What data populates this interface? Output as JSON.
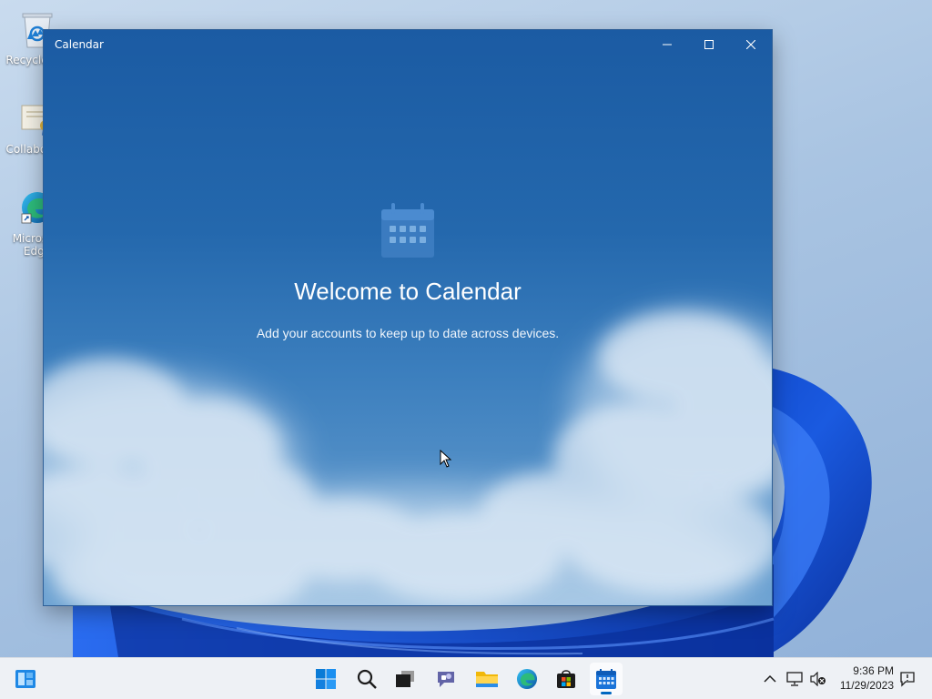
{
  "desktop": {
    "icons": [
      {
        "label": "Recycle Bin",
        "icon": "recycle-bin-icon"
      },
      {
        "label": "Collaborate",
        "icon": "certificate-icon"
      },
      {
        "label": "Microsoft Edge",
        "icon": "edge-icon"
      }
    ]
  },
  "window": {
    "title": "Calendar",
    "controls": [
      "minimize",
      "maximize",
      "close"
    ],
    "welcome_heading": "Welcome to Calendar",
    "welcome_subtitle": "Add your accounts to keep up to date across devices.",
    "icon": "calendar-icon"
  },
  "taskbar": {
    "apps": [
      {
        "name": "Start",
        "icon": "windows-start-icon"
      },
      {
        "name": "Search",
        "icon": "search-icon"
      },
      {
        "name": "Task View",
        "icon": "task-view-icon"
      },
      {
        "name": "Chat",
        "icon": "chat-icon"
      },
      {
        "name": "File Explorer",
        "icon": "folder-icon"
      },
      {
        "name": "Microsoft Edge",
        "icon": "edge-icon"
      },
      {
        "name": "Microsoft Store",
        "icon": "store-icon"
      },
      {
        "name": "Calendar",
        "icon": "calendar-icon",
        "active": true
      }
    ],
    "left_widget": "widgets-icon",
    "tray_icons": [
      "chevron-up-icon",
      "network-icon",
      "volume-muted-icon",
      "notification-icon"
    ],
    "time": "9:36 PM",
    "date": "11/29/2023"
  },
  "colors": {
    "accent": "#0067c0",
    "window_top": "#1b5ba3",
    "window_bottom": "#6ea3d2",
    "desktop_bloom": "#1a4fd0"
  }
}
